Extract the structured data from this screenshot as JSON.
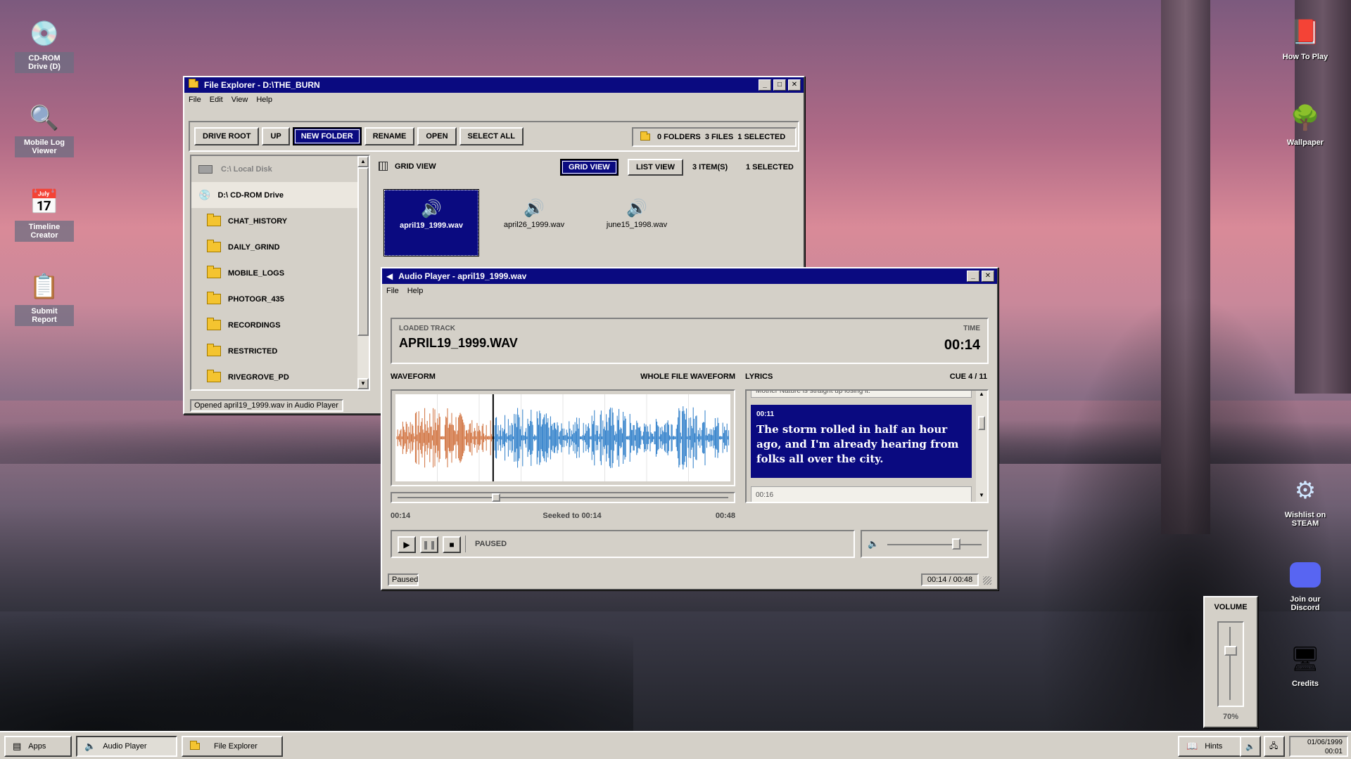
{
  "desktop": {
    "left_icons": [
      {
        "label": "CD-ROM Drive (D)",
        "icon": "cd-rom-icon"
      },
      {
        "label": "Mobile Log Viewer",
        "icon": "log-viewer-icon"
      },
      {
        "label": "Timeline Creator",
        "icon": "calendar-icon"
      },
      {
        "label": "Submit Report",
        "icon": "clipboard-icon"
      }
    ],
    "right_icons": [
      {
        "label": "How To Play",
        "icon": "help-book-icon"
      },
      {
        "label": "Wallpaper",
        "icon": "tree-icon"
      },
      {
        "label": "Wishlist on STEAM",
        "icon": "steam-icon"
      },
      {
        "label": "Join our Discord",
        "icon": "discord-icon"
      },
      {
        "label": "Credits",
        "icon": "computer-icon"
      }
    ]
  },
  "volume_panel": {
    "title": "VOLUME",
    "value_label": "70%",
    "level": 0.7
  },
  "explorer": {
    "title": "File Explorer - D:\\THE_BURN",
    "menu": [
      "File",
      "Edit",
      "View",
      "Help"
    ],
    "toolbar": [
      "DRIVE ROOT",
      "UP",
      "NEW FOLDER",
      "RENAME",
      "OPEN",
      "SELECT ALL"
    ],
    "summary": "0 FOLDERS  3 FILES  1 SELECTED",
    "tree": {
      "drives": [
        "C:\\ Local Disk",
        "D:\\ CD-ROM Drive"
      ],
      "folders": [
        "CHAT_HISTORY",
        "DAILY_GRIND",
        "MOBILE_LOGS",
        "PHOTOGR_435",
        "RECORDINGS",
        "RESTRICTED",
        "RIVEGROVE_PD"
      ]
    },
    "view_label": "GRID VIEW",
    "grid_button": "GRID VIEW",
    "list_button": "LIST VIEW",
    "items_count": "3 ITEM(S)",
    "selected_count": "1 SELECTED",
    "files": [
      "april19_1999.wav",
      "april26_1999.wav",
      "june15_1998.wav"
    ],
    "status": "Opened april19_1999.wav in Audio Player"
  },
  "player": {
    "title": "Audio Player - april19_1999.wav",
    "menu": [
      "File",
      "Help"
    ],
    "loaded_label": "LOADED TRACK",
    "track_name": "APRIL19_1999.WAV",
    "time_label": "TIME",
    "time_value": "00:14",
    "waveform_label": "WAVEFORM",
    "whole_label": "WHOLE FILE WAVEFORM",
    "lyrics_label": "LYRICS",
    "cue_label": "CUE 4 / 11",
    "lyric_prev": "Mother Nature is straight up losing it.",
    "lyric_time": "00:11",
    "lyric_text": "The storm rolled in half an hour ago, and I'm already hearing from folks all over the city.",
    "lyric_next": "00:16",
    "elapsed": "00:14",
    "seek_status": "Seeked to 00:14",
    "duration": "00:48",
    "progress": 0.2917,
    "state": "PAUSED",
    "volume_level": 0.75,
    "status_left": "Paused",
    "status_right": "00:14 / 00:48",
    "colors": {
      "played": "#d0703c",
      "unplayed": "#2a7cc8"
    }
  },
  "taskbar": {
    "start": "Apps",
    "tasks": [
      "Audio Player",
      "File Explorer"
    ],
    "hints": "Hints",
    "date": "01/06/1999",
    "time": "00:01"
  }
}
